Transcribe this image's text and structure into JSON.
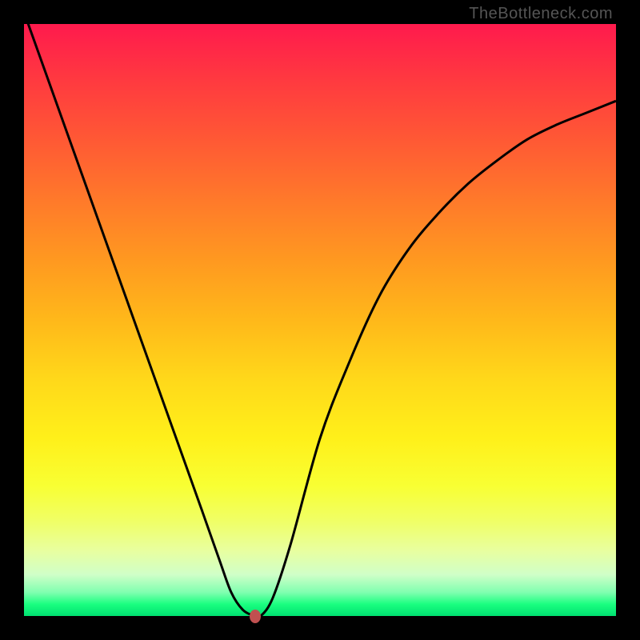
{
  "watermark": "TheBottleneck.com",
  "chart_data": {
    "type": "line",
    "title": "",
    "xlabel": "",
    "ylabel": "",
    "xlim": [
      0,
      100
    ],
    "ylim": [
      0,
      100
    ],
    "grid": false,
    "legend": false,
    "background_gradient": {
      "top": "#ff1a4d",
      "mid": "#ffd81a",
      "bottom": "#00e070"
    },
    "series": [
      {
        "name": "curve",
        "x": [
          0,
          5,
          10,
          15,
          20,
          25,
          30,
          33,
          35,
          37,
          39,
          40,
          42,
          45,
          50,
          55,
          60,
          65,
          70,
          75,
          80,
          85,
          90,
          95,
          100
        ],
        "y": [
          102,
          88,
          74,
          60,
          46,
          32,
          18,
          9.5,
          4,
          1,
          0,
          0,
          3,
          12,
          30,
          43,
          54,
          62,
          68,
          73,
          77,
          80.5,
          83,
          85,
          87
        ]
      }
    ],
    "marker": {
      "x": 39,
      "y": 0,
      "color": "#c05050"
    }
  }
}
